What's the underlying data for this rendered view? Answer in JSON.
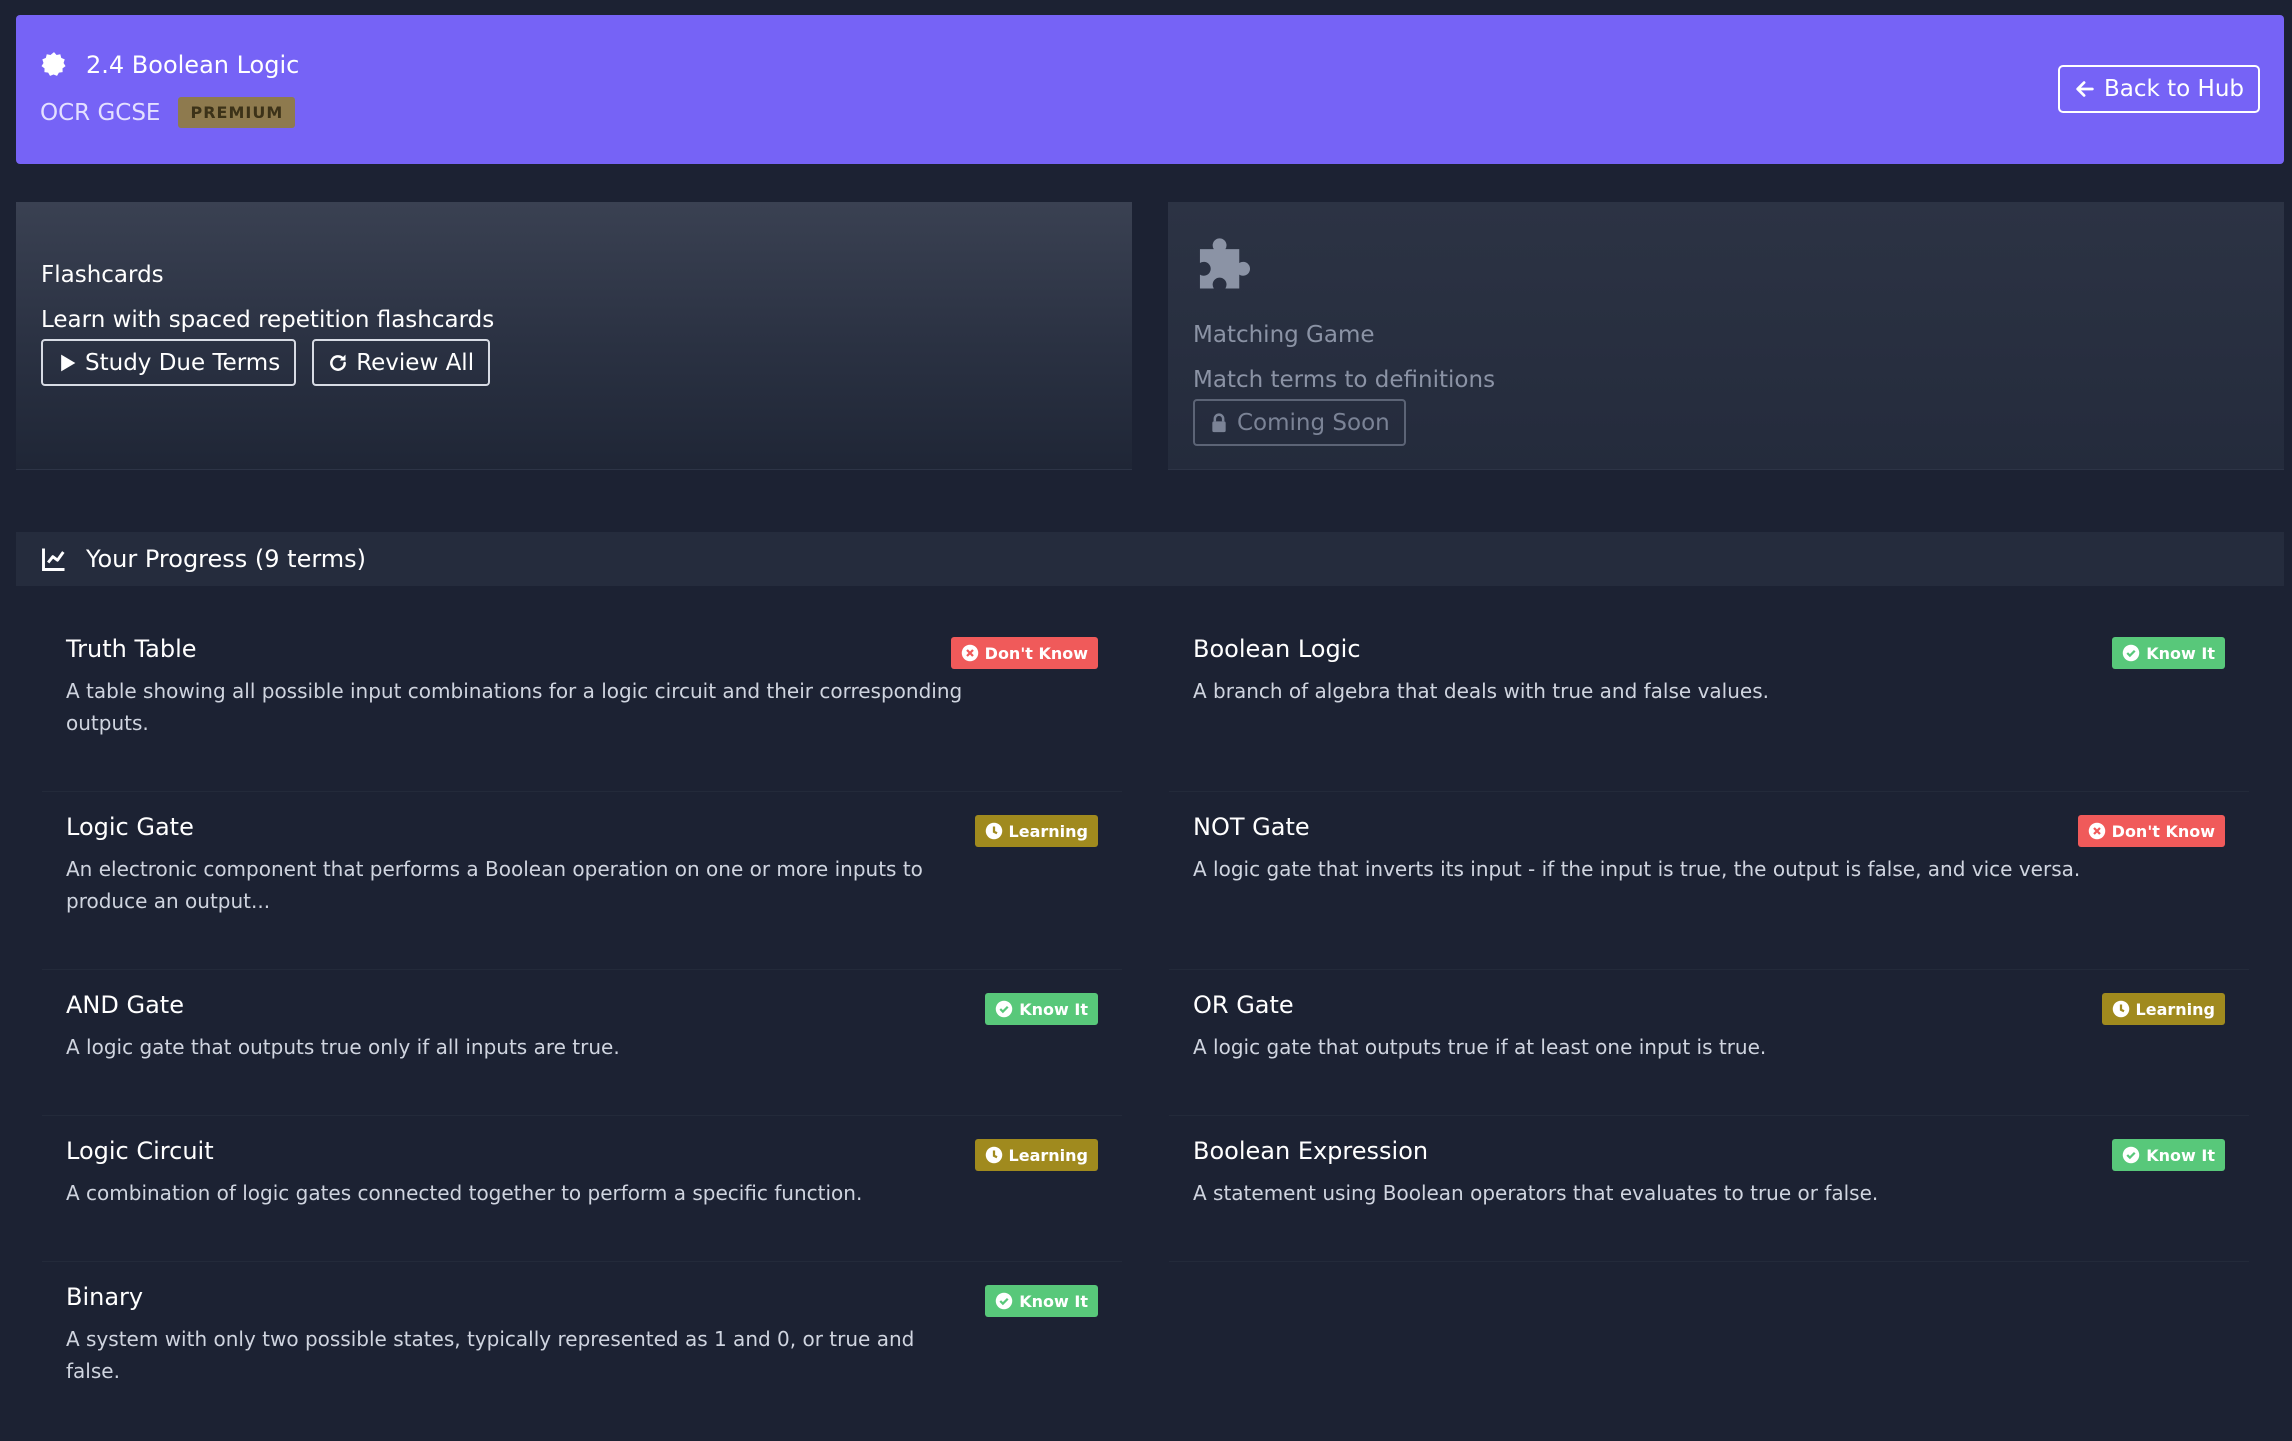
{
  "header": {
    "title": "2.4 Boolean Logic",
    "course": "OCR GCSE",
    "badge": "PREMIUM",
    "back_label": "Back to Hub",
    "bg_color": "#7663f6"
  },
  "flashcards": {
    "title": "Flashcards",
    "description": "Learn with spaced repetition flashcards",
    "study_label": "Study Due Terms",
    "review_label": "Review All"
  },
  "matching": {
    "icon": "puzzle-icon",
    "title": "Matching Game",
    "description": "Match terms to definitions",
    "button_label": "Coming Soon"
  },
  "progress": {
    "title": "Your Progress (9 terms)"
  },
  "terms": [
    {
      "name": "Truth Table",
      "definition": "A table showing all possible input combinations for a logic circuit and their corresponding outputs.",
      "status": "Don't Know"
    },
    {
      "name": "Boolean Logic",
      "definition": "A branch of algebra that deals with true and false values.",
      "status": "Know It"
    },
    {
      "name": "Logic Gate",
      "definition": "An electronic component that performs a Boolean operation on one or more inputs to produce an output...",
      "status": "Learning"
    },
    {
      "name": "NOT Gate",
      "definition": "A logic gate that inverts its input - if the input is true, the output is false, and vice versa.",
      "status": "Don't Know"
    },
    {
      "name": "AND Gate",
      "definition": "A logic gate that outputs true only if all inputs are true.",
      "status": "Know It"
    },
    {
      "name": "OR Gate",
      "definition": "A logic gate that outputs true if at least one input is true.",
      "status": "Learning"
    },
    {
      "name": "Logic Circuit",
      "definition": "A combination of logic gates connected together to perform a specific function.",
      "status": "Learning"
    },
    {
      "name": "Boolean Expression",
      "definition": "A statement using Boolean operators that evaluates to true or false.",
      "status": "Know It"
    },
    {
      "name": "Binary",
      "definition": "A system with only two possible states, typically represented as 1 and 0, or true and false.",
      "status": "Know It"
    }
  ],
  "status_colors": {
    "Don't Know": "#f05a5a",
    "Know It": "#58c87a",
    "Learning": "#a08a1e"
  }
}
